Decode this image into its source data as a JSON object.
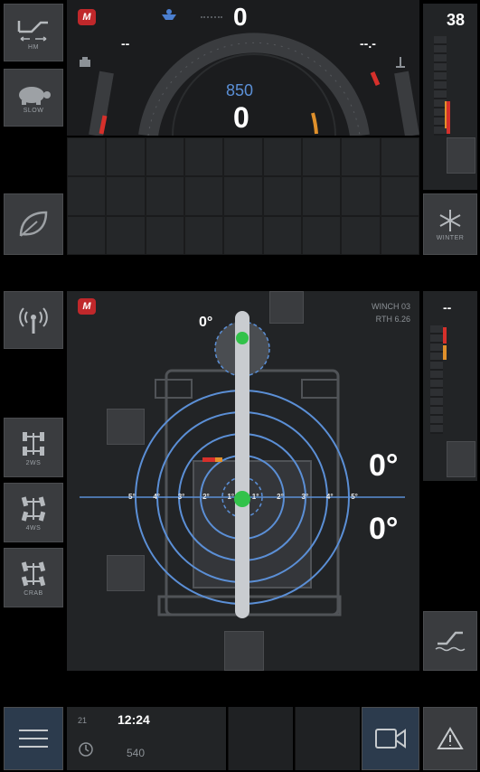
{
  "top": {
    "brand_badge": "M",
    "top_value": "0",
    "left_dash": "--",
    "right_dash": "--.-",
    "center_small": "850",
    "center_big": "0",
    "right_number": "38"
  },
  "left_buttons": {
    "btn1_label": "HM",
    "btn2_label": "SLOW"
  },
  "right_buttons": {
    "winter_label": "WINTER"
  },
  "middle": {
    "brand_badge": "M",
    "angle_top": "0°",
    "winch_label": "WINCH 03",
    "rth_label": "RTH 6.26",
    "angle_right_1": "0°",
    "angle_right_2": "0°",
    "right_dash": "--",
    "ring_labels": [
      "5°",
      "4°",
      "3°",
      "2°",
      "1°",
      "1°",
      "2°",
      "3°",
      "4°",
      "5°"
    ]
  },
  "side_modes": [
    {
      "label": "2WS"
    },
    {
      "label": "4WS"
    },
    {
      "label": "CRAB"
    }
  ],
  "bottom": {
    "left_num": "21",
    "time": "12:24",
    "bottom_num": "540"
  },
  "colors": {
    "accent_blue": "#5b8fd6",
    "green": "#32c24a",
    "red": "#d6302b",
    "orange": "#e0902b"
  }
}
